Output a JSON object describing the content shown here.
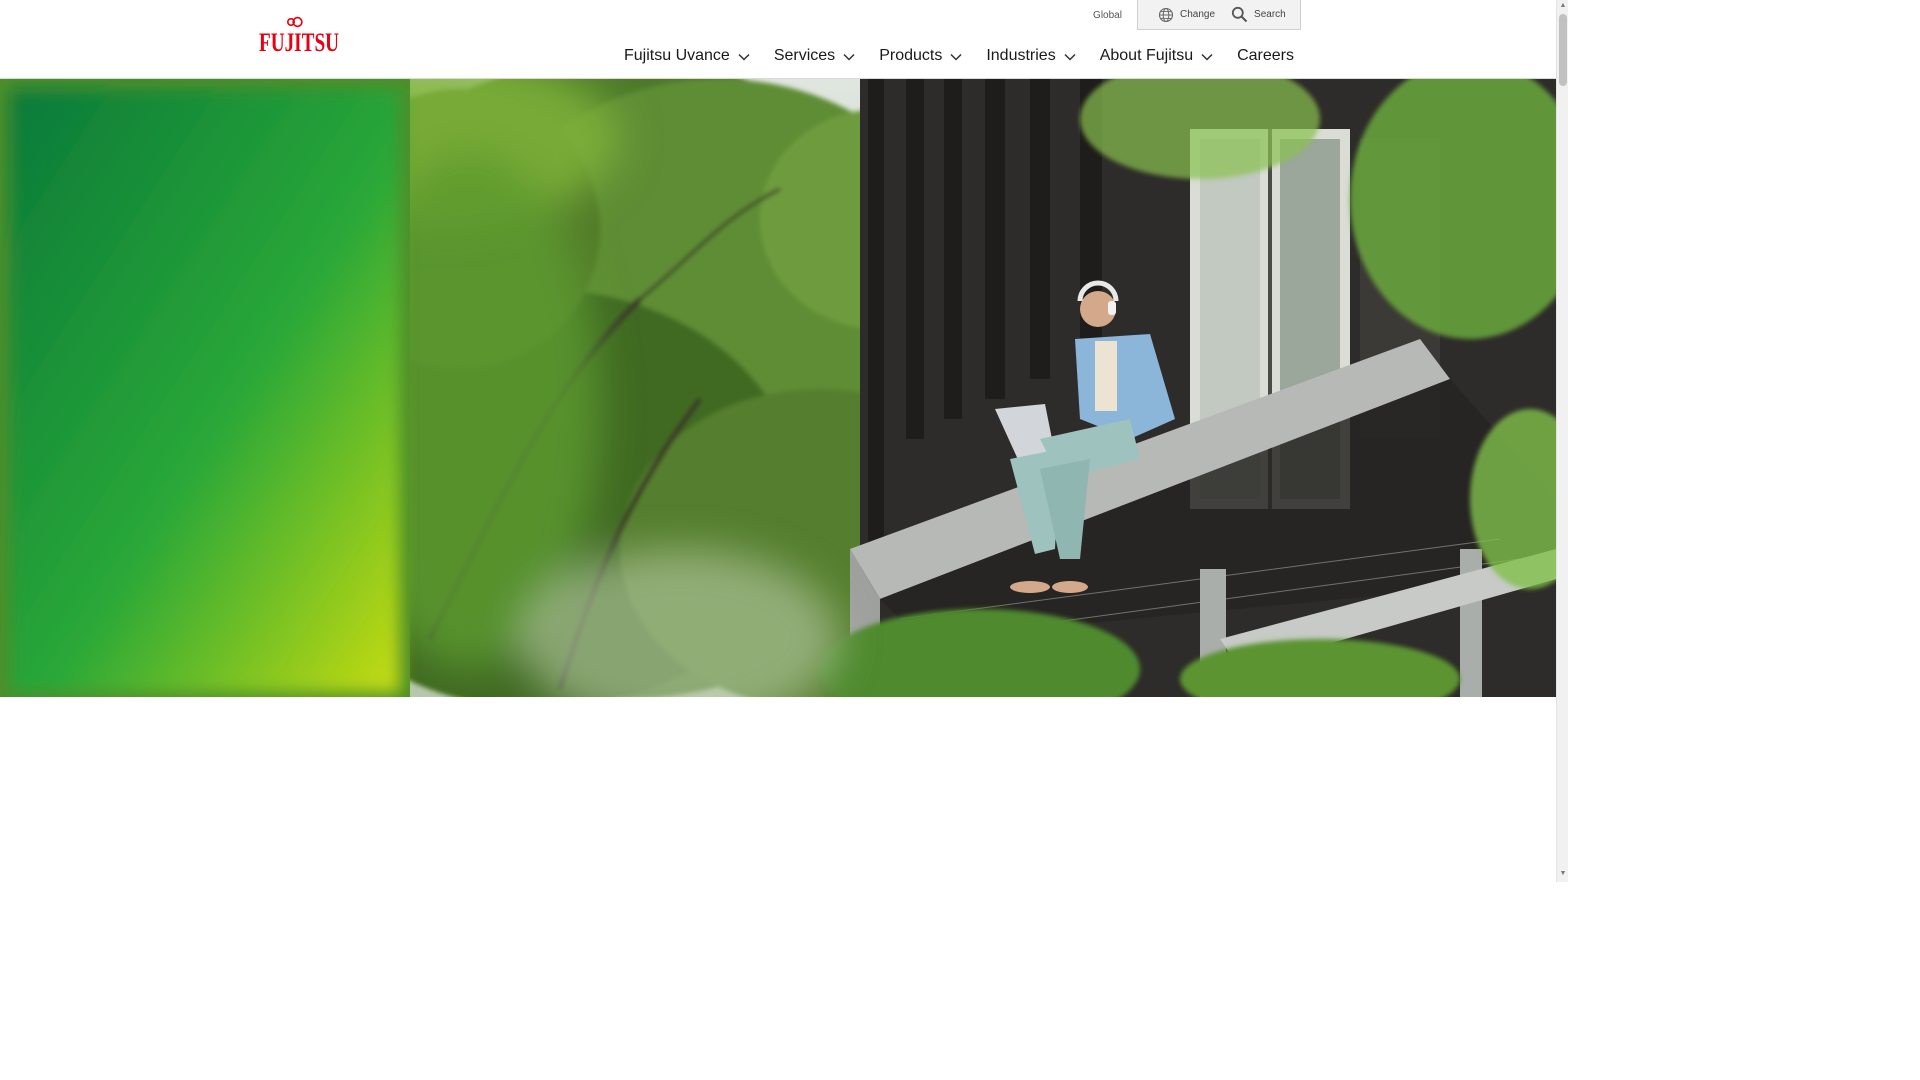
{
  "header": {
    "logo_text": "FUJITSU",
    "region_label": "Global",
    "change_label": "Change",
    "search_label": "Search"
  },
  "nav": {
    "items": [
      {
        "label": "Fujitsu Uvance",
        "has_dropdown": true
      },
      {
        "label": "Services",
        "has_dropdown": true
      },
      {
        "label": "Products",
        "has_dropdown": true
      },
      {
        "label": "Industries",
        "has_dropdown": true
      },
      {
        "label": "About Fujitsu",
        "has_dropdown": true
      },
      {
        "label": "Careers",
        "has_dropdown": false
      }
    ]
  },
  "colors": {
    "brand_red": "#e60012",
    "hero_green_dark": "#0a7a3a",
    "hero_green_light": "#c8dc10"
  },
  "icons": [
    "globe-icon",
    "search-icon",
    "chevron-down-icon"
  ]
}
